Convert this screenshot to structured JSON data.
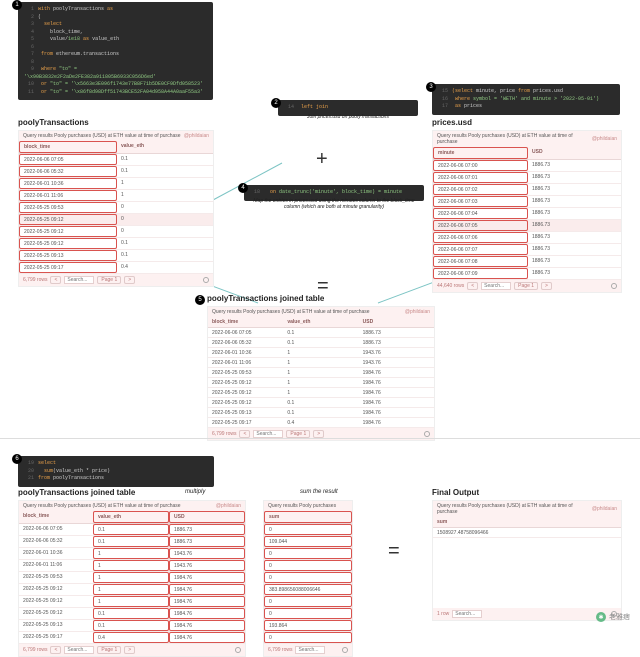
{
  "badges": {
    "b1": "1",
    "b2": "2",
    "b3": "3",
    "b4": "4",
    "b5": "5",
    "b6": "6"
  },
  "ops": {
    "plus": "+",
    "eq1": "=",
    "eq2": "="
  },
  "code1": {
    "l1_a": "with",
    "l1_b": " poolyTransactions ",
    "l1_c": "as",
    "l2": "(",
    "l3": "select",
    "l4": "block_time,",
    "l5_a": "value/",
    "l5_b": "1e18",
    "l5_c": " as ",
    "l5_d": "value_eth",
    "l7_a": "from ",
    "l7_b": "ethereum.transactions",
    "l9_a": "where ",
    "l9_b": "\"to\" = '\\x90B3832e2F2aDe2FE382a911805B6933C056D6ed'",
    "l10_a": "or ",
    "l10_b": "\"to\" = '\\x5663e3E096f1743e77B8F71b5DE0CF9Dfd058523'",
    "l11_a": "or ",
    "l11_b": "\"to\" = '\\x86f8d98Dff51743BCE52FA04d958A44A0aaF55a3'"
  },
  "code2": {
    "text": "  left join"
  },
  "caption2": "Join prices.usd on poolyTransactions",
  "code3": {
    "l1_a": "(select",
    "l1_b": " minute, price ",
    "l1_c": "from",
    "l1_d": " prices.usd",
    "l2_a": "where ",
    "l2_b": "symbol = 'WETH' and minute > '2022-05-01')",
    "l3_a": "as ",
    "l3_b": "prices"
  },
  "code4": {
    "a": "on ",
    "b": "date_trunc('minute', block_time) = minute"
  },
  "caption4": "Map the entries in prices.usd using the minutes column to the block_time column (which are both at minute granularity)",
  "code6": {
    "l1": "select",
    "l2_a": "sum",
    "l2_b": "(value_eth * price)",
    "l3_a": "from ",
    "l3_b": "poolyTransactions"
  },
  "titles": {
    "t1": "poolyTransactions",
    "t3": "prices.usd",
    "t5": "poolyTransactions joined table",
    "t6": "poolyTransactions joined table",
    "tfinal": "Final Output"
  },
  "labels": {
    "multiply": "multiply",
    "sum": "sum the result"
  },
  "qheader": {
    "a": "Query results   Pooly purchases (USD) at ETH value at time of purchase",
    "b": "Query results   Pooly purchases (USD) at ETH value at time of purchase",
    "c": "Query results   Pooly purchases",
    "d": "Query results   Pooly purchases (USD) at ETH value at time of purchase",
    "author": "@phildaian"
  },
  "footer": {
    "rows1": "6,799 rows",
    "rows3": "44,640 rows",
    "rows5": "6,799 rows",
    "rowsF": "1 row",
    "search": "Search...",
    "page": "Page 1",
    "prev": "<",
    "next": ">"
  },
  "cols": {
    "c_bt": "block_time",
    "c_ve": "value_eth",
    "c_min": "minute",
    "c_usd": "USD",
    "c_sum": "sum"
  },
  "t1rows": [
    {
      "bt": "2022-06-06 07:05",
      "ve": "0.1"
    },
    {
      "bt": "2022-06-06 05:32",
      "ve": "0.1"
    },
    {
      "bt": "2022-06-01 10:36",
      "ve": "1"
    },
    {
      "bt": "2022-06-01 11:06",
      "ve": "1"
    },
    {
      "bt": "2022-05-25 09:53",
      "ve": "0"
    },
    {
      "bt": "2022-05-25 09:12",
      "ve": "0"
    },
    {
      "bt": "2022-05-25 09:12",
      "ve": "0"
    },
    {
      "bt": "2022-05-25 09:12",
      "ve": "0.1"
    },
    {
      "bt": "2022-05-25 09:13",
      "ve": "0.1"
    },
    {
      "bt": "2022-05-25 09:17",
      "ve": "0.4"
    }
  ],
  "t3rows": [
    {
      "m": "2022-06-06 07:00",
      "u": "1886.73"
    },
    {
      "m": "2022-06-06 07:01",
      "u": "1886.73"
    },
    {
      "m": "2022-06-06 07:02",
      "u": "1886.73"
    },
    {
      "m": "2022-06-06 07:03",
      "u": "1886.73"
    },
    {
      "m": "2022-06-06 07:04",
      "u": "1886.73"
    },
    {
      "m": "2022-06-06 07:05",
      "u": "1886.73"
    },
    {
      "m": "2022-06-06 07:06",
      "u": "1886.73"
    },
    {
      "m": "2022-06-06 07:07",
      "u": "1886.73"
    },
    {
      "m": "2022-06-06 07:08",
      "u": "1886.73"
    },
    {
      "m": "2022-06-06 07:09",
      "u": "1886.73"
    }
  ],
  "t5rows": [
    {
      "bt": "2022-06-06 07:05",
      "ve": "0.1",
      "u": "1886.73"
    },
    {
      "bt": "2022-06-06 05:32",
      "ve": "0.1",
      "u": "1886.73"
    },
    {
      "bt": "2022-06-01 10:36",
      "ve": "1",
      "u": "1943.76"
    },
    {
      "bt": "2022-06-01 11:06",
      "ve": "1",
      "u": "1943.76"
    },
    {
      "bt": "2022-05-25 09:53",
      "ve": "1",
      "u": "1984.76"
    },
    {
      "bt": "2022-05-25 09:12",
      "ve": "1",
      "u": "1984.76"
    },
    {
      "bt": "2022-05-25 09:12",
      "ve": "1",
      "u": "1984.76"
    },
    {
      "bt": "2022-05-25 09:12",
      "ve": "0.1",
      "u": "1984.76"
    },
    {
      "bt": "2022-05-25 09:13",
      "ve": "0.1",
      "u": "1984.76"
    },
    {
      "bt": "2022-05-25 09:17",
      "ve": "0.4",
      "u": "1984.76"
    }
  ],
  "t6rows": [
    {
      "bt": "2022-06-06 07:05",
      "ve": "0.1",
      "u": "1886.73"
    },
    {
      "bt": "2022-06-06 05:32",
      "ve": "0.1",
      "u": "1886.73"
    },
    {
      "bt": "2022-06-01 10:36",
      "ve": "1",
      "u": "1943.76"
    },
    {
      "bt": "2022-06-01 11:06",
      "ve": "1",
      "u": "1943.76"
    },
    {
      "bt": "2022-05-25 09:53",
      "ve": "1",
      "u": "1984.76"
    },
    {
      "bt": "2022-05-25 09:12",
      "ve": "1",
      "u": "1984.76"
    },
    {
      "bt": "2022-05-25 09:12",
      "ve": "1",
      "u": "1984.76"
    },
    {
      "bt": "2022-05-25 09:12",
      "ve": "0.1",
      "u": "1984.76"
    },
    {
      "bt": "2022-05-25 09:13",
      "ve": "0.1",
      "u": "1984.76"
    },
    {
      "bt": "2022-05-25 09:17",
      "ve": "0.4",
      "u": "1984.76"
    }
  ],
  "sumrows": [
    {
      "s": "0"
    },
    {
      "s": "109.044"
    },
    {
      "s": "0"
    },
    {
      "s": "0"
    },
    {
      "s": "0"
    },
    {
      "s": "383.898656088006646"
    },
    {
      "s": "0"
    },
    {
      "s": "0"
    },
    {
      "s": "193.864"
    },
    {
      "s": "0"
    }
  ],
  "final": {
    "sumlabel": "sum",
    "value": "1508927.48758096466"
  },
  "watermark": "老雅痞"
}
